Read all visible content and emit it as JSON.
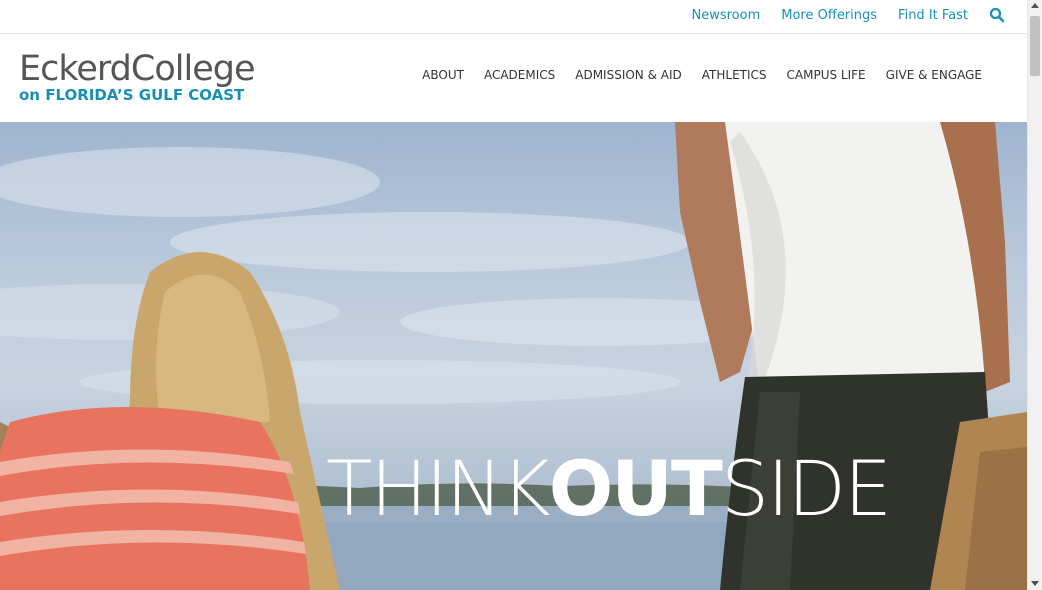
{
  "utility_nav": {
    "links": [
      "Newsroom",
      "More Offerings",
      "Find It Fast"
    ],
    "search_icon": "search-icon"
  },
  "logo": {
    "main": "EckerdCollege",
    "sub": "on FLORIDA’S GULF COAST"
  },
  "main_nav": {
    "items": [
      "ABOUT",
      "ACADEMICS",
      "ADMISSION & AID",
      "ATHLETICS",
      "CAMPUS LIFE",
      "GIVE & ENGAGE"
    ]
  },
  "hero": {
    "headline_part1": "THINK",
    "headline_part2": "OUT",
    "headline_part3": "SIDE"
  },
  "colors": {
    "accent": "#1a8fb5",
    "logo_gray": "#555555",
    "nav_text": "#333333"
  }
}
